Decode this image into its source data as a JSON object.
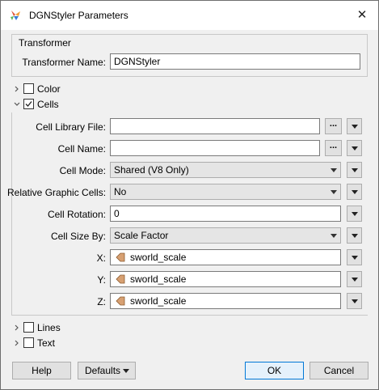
{
  "window": {
    "title": "DGNStyler Parameters"
  },
  "transformer": {
    "group_title": "Transformer",
    "name_label": "Transformer Name:",
    "name_value": "DGNStyler"
  },
  "sections": {
    "color": {
      "label": "Color",
      "checked": false
    },
    "cells": {
      "label": "Cells",
      "checked": true
    },
    "lines": {
      "label": "Lines",
      "checked": false
    },
    "text": {
      "label": "Text",
      "checked": false
    }
  },
  "cells": {
    "library_file_label": "Cell Library File:",
    "library_file_value": "",
    "cell_name_label": "Cell Name:",
    "cell_name_value": "",
    "cell_mode_label": "Cell Mode:",
    "cell_mode_value": "Shared (V8 Only)",
    "relative_graphic_label": "Relative Graphic Cells:",
    "relative_graphic_value": "No",
    "rotation_label": "Cell Rotation:",
    "rotation_value": "0",
    "size_by_label": "Cell Size By:",
    "size_by_value": "Scale Factor",
    "x_label": "X:",
    "x_value": "sworld_scale",
    "y_label": "Y:",
    "y_value": "sworld_scale",
    "z_label": "Z:",
    "z_value": "sworld_scale"
  },
  "footer": {
    "help_label": "Help",
    "defaults_label": "Defaults",
    "ok_label": "OK",
    "cancel_label": "Cancel"
  },
  "ellipsis": "...",
  "colors": {
    "attr_icon": "#d7a072",
    "accent": "#0078d7"
  }
}
